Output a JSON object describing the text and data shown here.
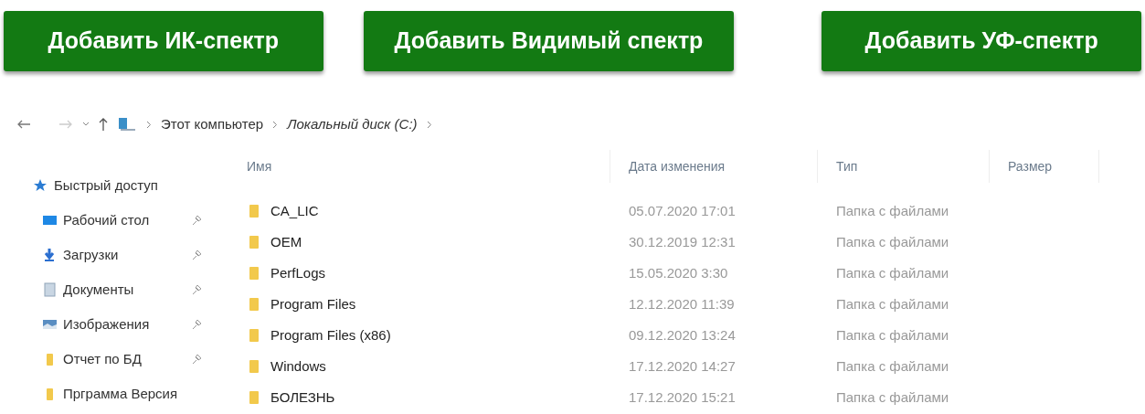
{
  "buttons": [
    "Добавить ИК-спектр",
    "Добавить Видимый спектр",
    "Добавить УФ-спектр"
  ],
  "breadcrumb": [
    "Этот компьютер",
    "Локальный диск (C:)"
  ],
  "sidebar": {
    "items": [
      {
        "label": "Быстрый доступ",
        "kind": "star",
        "pinned": false,
        "children": [
          {
            "label": "Рабочий стол",
            "kind": "desktop",
            "pinned": true
          },
          {
            "label": "Загрузки",
            "kind": "download",
            "pinned": true
          },
          {
            "label": "Документы",
            "kind": "documents",
            "pinned": true
          },
          {
            "label": "Изображения",
            "kind": "pictures",
            "pinned": true
          },
          {
            "label": "Отчет по БД",
            "kind": "folder",
            "pinned": true
          },
          {
            "label": "Прграмма Версия",
            "kind": "folder",
            "pinned": false
          }
        ]
      }
    ]
  },
  "table": {
    "columns": [
      "Имя",
      "Дата изменения",
      "Тип",
      "Размер"
    ],
    "rows": [
      [
        "CA_LIC",
        "05.07.2020 17:01",
        "Папка с файлами"
      ],
      [
        "OEM",
        "30.12.2019 12:31",
        "Папка с файлами"
      ],
      [
        "PerfLogs",
        "15.05.2020 3:30",
        "Папка с файлами"
      ],
      [
        "Program Files",
        "12.12.2020 11:39",
        "Папка с файлами"
      ],
      [
        "Program Files (x86)",
        "09.12.2020 13:24",
        "Папка с файлами"
      ],
      [
        "Windows",
        "17.12.2020 14:27",
        "Папка с файлами"
      ],
      [
        "БОЛЕЗНЬ",
        "17.12.2020 15:21",
        "Папка с файлами"
      ]
    ]
  }
}
